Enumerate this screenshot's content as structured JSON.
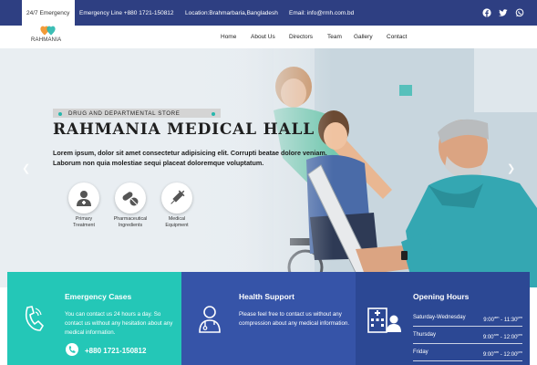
{
  "topbar": {
    "badge": "24/7 Emergency",
    "emergency_line": "Emergency Line +880 1721-150812",
    "location": "Location:Brahmarbaria,Bangladesh",
    "email": "Email: info@rmh.com.bd",
    "social_icons": [
      "facebook-icon",
      "twitter-icon",
      "whatsapp-icon"
    ]
  },
  "brand": {
    "name": "RAHMANIA"
  },
  "nav": {
    "items": [
      "Home",
      "About Us",
      "Directors",
      "Team",
      "Gallery",
      "Contact"
    ]
  },
  "hero": {
    "subtitle": "DRUG AND DEPARTMENTAL STORE",
    "title": "RAHMANIA MEDICAL HALL",
    "description": "Lorem ipsum, dolor sit amet consectetur adipisicing elit. Corrupti beatae dolore veniam. Laborum non quia molestiae sequi placeat doloremque voluptatum.",
    "features": [
      {
        "label_1": "Primary",
        "label_2": "Treatment",
        "icon": "doctor-icon"
      },
      {
        "label_1": "Pharmaceutical",
        "label_2": "Ingredients",
        "icon": "pills-icon"
      },
      {
        "label_1": "Medical",
        "label_2": "Equipment",
        "icon": "syringe-icon"
      }
    ]
  },
  "cards": {
    "emergency": {
      "title": "Emergency Cases",
      "text": "You can contact us 24 hours a day. So contact us without any hesitation about any medical information.",
      "phone": "+880 1721-150812"
    },
    "support": {
      "title": "Health Support",
      "text": "Please feel free to contact us without any compression about any medical information."
    },
    "hours": {
      "title": "Opening Hours",
      "rows": [
        {
          "day": "Saturday-Wednesday",
          "time_open": "9:00",
          "time_close": "11:30"
        },
        {
          "day": "Thursday",
          "time_open": "9:00",
          "time_close": "12:00"
        },
        {
          "day": "Friday",
          "time_open": "9:00",
          "time_close": "12:00"
        }
      ],
      "am": "am",
      "pm": "pm"
    }
  },
  "colors": {
    "topbar": "#2e3f82",
    "teal": "#24c7b7",
    "royal": "#3654a8",
    "navy": "#2c4894",
    "accent": "#27b7ad"
  }
}
